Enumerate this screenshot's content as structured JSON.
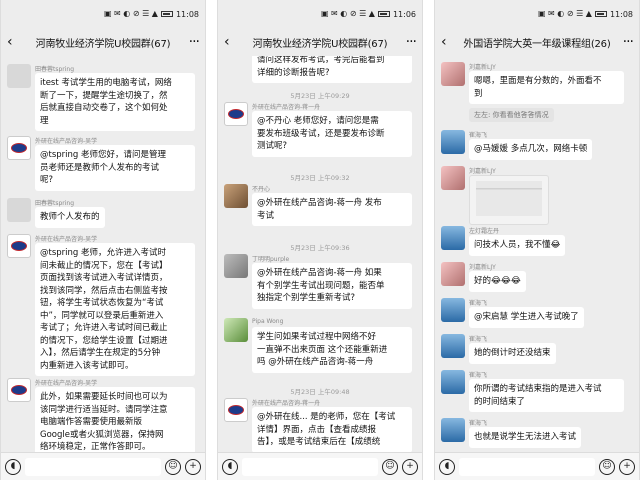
{
  "status": {
    "time1": "11:08",
    "time2": "11:06",
    "time3": "11:08",
    "icons": "▣ ✉ ◐ ⊘ ☰ ▲"
  },
  "phone1": {
    "title": "河南牧业经济学院U校园群(67)",
    "messages": [
      {
        "sender": "田春蓉tspring",
        "avatar": "blank",
        "lines": [
          "itest 考试学生用的电脑考试，网络",
          "断了一下，提醒学生途切换了，然",
          "后就直接自动交卷了，这个如何处",
          "理"
        ]
      },
      {
        "sender": "外研在线产品咨询-吴学",
        "avatar": "logo",
        "lines": [
          "@tspring 老师您好，请问是管理",
          "员老师还是教师个人发布的考试",
          "呢?"
        ]
      },
      {
        "sender": "田春蓉tspring",
        "avatar": "blank",
        "lines": [
          "教师个人发布的"
        ]
      },
      {
        "sender": "外研在线产品咨询-吴学",
        "avatar": "logo",
        "lines": [
          "@tspring 老师，允许进入考试时",
          "间未截止的情况下，您在【考试】",
          "页面找到该考试进入考试详情页，",
          "找到该同学，然后点击右侧监考按",
          "钮，将学生考试状态恢复为“考试",
          "中”，同学就可以登录后重新进入",
          "考试了；允许进入考试时间已截止",
          "的情况下，您给学生设置【过期进",
          "入】，然后请学生在规定的5分钟",
          "内重新进入该考试即可。"
        ]
      },
      {
        "sender": "外研在线产品咨询-吴学",
        "avatar": "logo",
        "lines": [
          "此外，如果需要延长时间也可以为",
          "该同学进行适当延时。请同学注意",
          "电脑端作答需要使用最新版",
          "Google或者火狐浏览器，保持网",
          "络环境稳定，正常作答即可。"
        ]
      }
    ]
  },
  "phone2": {
    "title": "河南牧业经济学院U校园群(67)",
    "top_lines": [
      "请问这样发布考试，考完后能看到",
      "详细的诊断报告呢?"
    ],
    "times": [
      "5月23日 上午09:29",
      "5月23日 上午09:32",
      "5月23日 上午09:36",
      "5月23日 上午09:48"
    ],
    "messages": [
      {
        "sender": "外研在线产品咨询-蒋一舟",
        "avatar": "logo",
        "lines": [
          "@不丹心 老师您好，请问您是需",
          "要发布班级考试，还是要发布诊断",
          "测试呢?"
        ]
      },
      {
        "sender": "不丹心",
        "avatar": "cat",
        "lines": [
          "@外研在线产品咨询-蒋一舟 发布",
          "考试"
        ]
      },
      {
        "sender": "丁明明purple",
        "avatar": "grey",
        "lines": [
          "@外研在线产品咨询-蒋一舟 如果",
          "有个别学生考试出现问题，能否单",
          "独指定个别学生重新考试?"
        ]
      },
      {
        "sender": "Pipa Wong",
        "avatar": "green",
        "lines": [
          "学生问如果考试过程中网络不好",
          "一直弹不出来页面 这个还能重新进",
          "吗 @外研在线产品咨询-蒋一舟"
        ]
      },
      {
        "sender": "外研在线产品咨询-蒋一舟",
        "avatar": "logo",
        "lines": [
          "@外研在线... 是的老师，您在【考试",
          "详情】界面，点击【查看成绩报",
          "告】，或是考试结束后在【成绩统"
        ]
      }
    ]
  },
  "phone3": {
    "title": "外国语学院大英一年级课程组(26)",
    "quote": "左左: 你看看他答答情况",
    "messages": [
      {
        "sender": "刘嘉新LJY",
        "avatar": "person",
        "lines": [
          "嗯嗯，里面是有分数的，外面看不",
          "到"
        ]
      },
      {
        "sender": "崔海飞",
        "avatar": "sea",
        "lines": [
          "@马媛媛  多点几次，网络卡顿"
        ]
      },
      {
        "sender": "刘嘉新LJY",
        "avatar": "person",
        "lines": [],
        "photo": true
      },
      {
        "sender": "左灯霜左丹",
        "avatar": "sea",
        "lines": [
          "问技术人员，我不懂😂"
        ]
      },
      {
        "sender": "刘嘉新LJY",
        "avatar": "person",
        "lines": [
          "好的😂😂😂"
        ]
      },
      {
        "sender": "崔海飞",
        "avatar": "sea",
        "lines": [
          "@宋启慧  学生进入考试晚了"
        ]
      },
      {
        "sender": "崔海飞",
        "avatar": "sea",
        "lines": [
          "她的倒计时还没结束"
        ]
      },
      {
        "sender": "崔海飞",
        "avatar": "sea",
        "lines": [
          "你所谓的考试结束指的是进入考试",
          "的时间结束了"
        ]
      },
      {
        "sender": "崔海飞",
        "avatar": "sea",
        "lines": [
          "也就是说学生无法进入考试"
        ]
      }
    ]
  }
}
